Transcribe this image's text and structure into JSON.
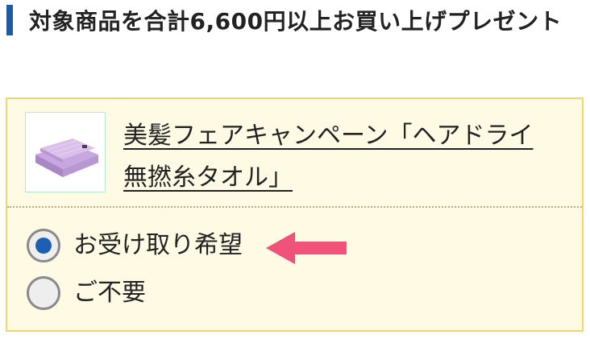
{
  "heading": {
    "text": "対象商品を合計6,600円以上お買い上げプレゼント"
  },
  "gift": {
    "product_name": "美髪フェアキャンペーン「ヘアドライ 無撚糸タオル」",
    "product_image_icon": "folded-lavender-towel",
    "options": [
      {
        "label": "お受け取り希望",
        "selected": true
      },
      {
        "label": "ご不要",
        "selected": false
      }
    ]
  },
  "colors": {
    "heading_accent": "#1f5aa6",
    "box_background": "#fffae3",
    "box_border": "#f0d862",
    "radio_selected": "#1d5fb0",
    "arrow": "#f0527a",
    "towel": "#c8a6df"
  }
}
